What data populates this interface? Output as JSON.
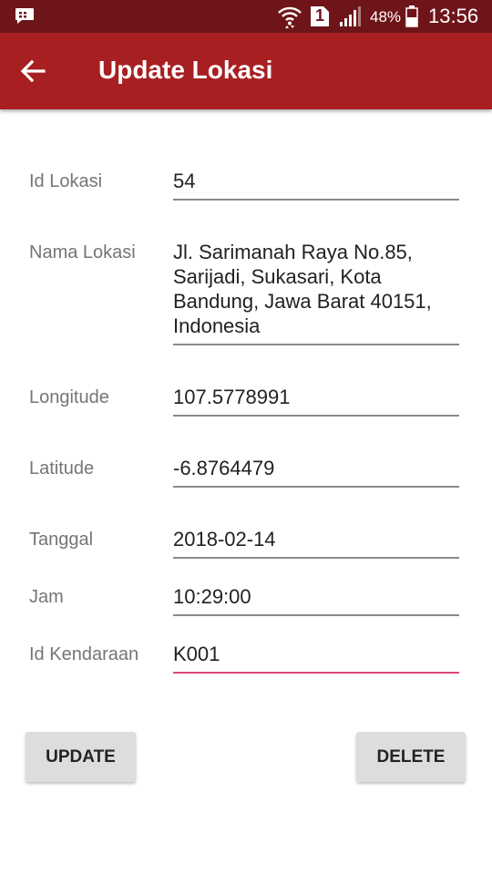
{
  "status_bar": {
    "battery": "48%",
    "time": "13:56",
    "sim_slot": "1"
  },
  "app_bar": {
    "title": "Update Lokasi"
  },
  "form": {
    "id_lokasi": {
      "label": "Id Lokasi",
      "value": "54"
    },
    "nama_lokasi": {
      "label": "Nama Lokasi",
      "value_lines": [
        "Jl. Sarimanah Raya No.85,",
        "Sarijadi, Sukasari, Kota",
        "Bandung, Jawa Barat 40151,",
        "Indonesia"
      ]
    },
    "longitude": {
      "label": "Longitude",
      "value": "107.5778991"
    },
    "latitude": {
      "label": "Latitude",
      "value": "-6.8764479"
    },
    "tanggal": {
      "label": "Tanggal",
      "value": "2018-02-14"
    },
    "jam": {
      "label": "Jam",
      "value": "10:29:00"
    },
    "id_kendaraan": {
      "label": "Id Kendaraan",
      "value": "K001"
    }
  },
  "buttons": {
    "update": "UPDATE",
    "delete": "DELETE"
  },
  "colors": {
    "status_bar": "#6e1519",
    "app_bar": "#a81f22",
    "focus_underline": "#e0457c"
  }
}
